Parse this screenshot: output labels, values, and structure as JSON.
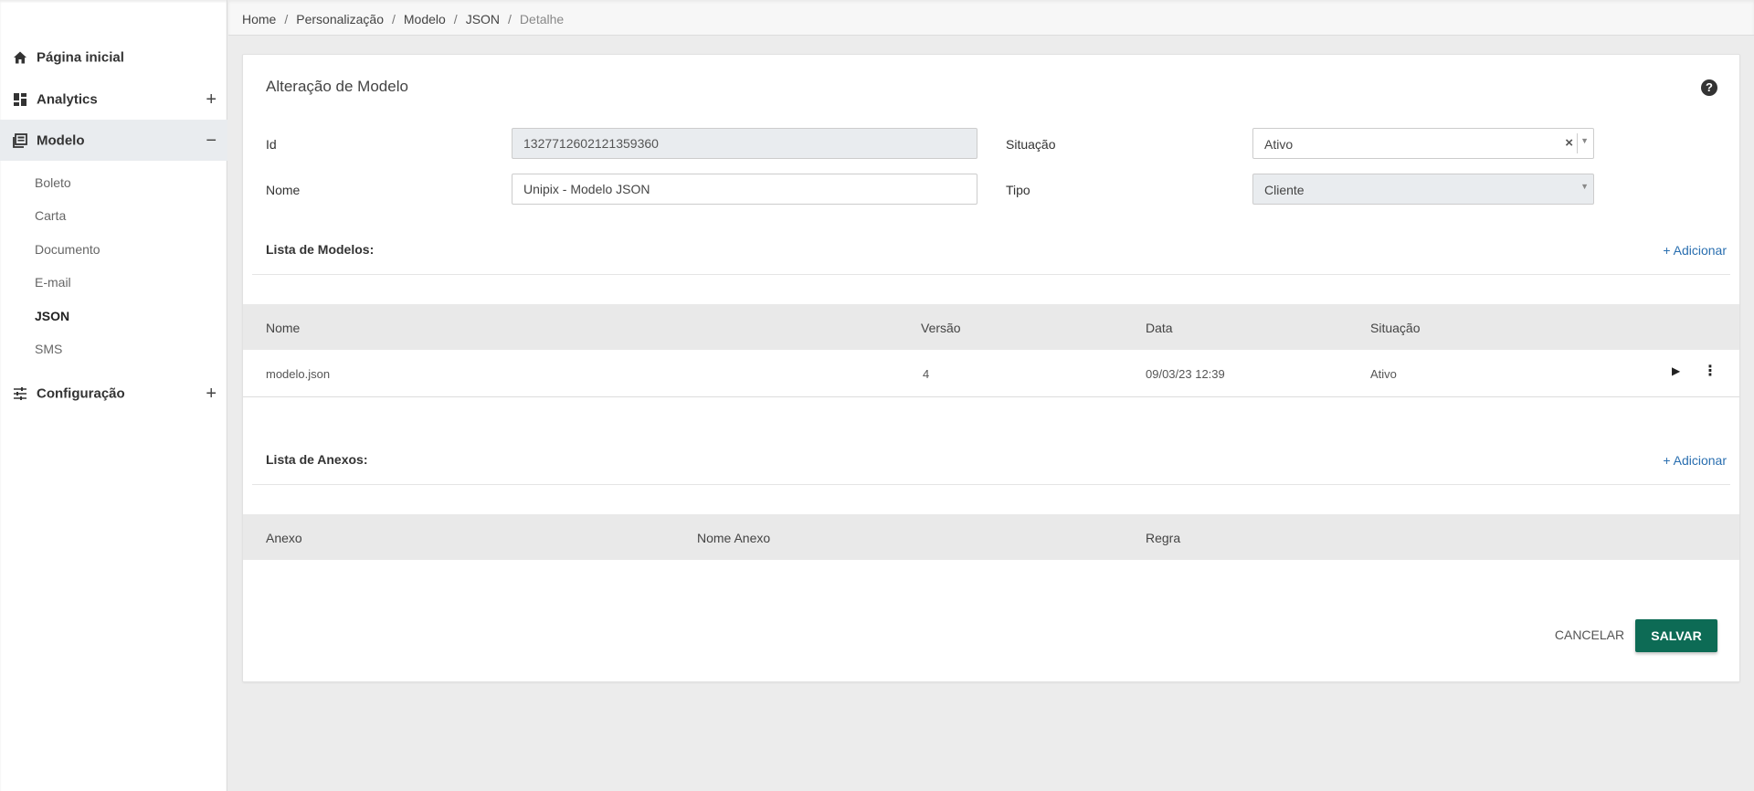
{
  "sidebar": {
    "items": [
      {
        "label": "Página inicial",
        "icon": "home-icon"
      },
      {
        "label": "Analytics",
        "icon": "dashboard-icon",
        "toggle": "+"
      },
      {
        "label": "Modelo",
        "icon": "book-icon",
        "toggle": "−"
      },
      {
        "label": "Configuração",
        "icon": "sliders-icon",
        "toggle": "+"
      }
    ],
    "subitems": [
      "Boleto",
      "Carta",
      "Documento",
      "E-mail",
      "JSON",
      "SMS"
    ]
  },
  "breadcrumb": [
    "Home",
    "Personalização",
    "Modelo",
    "JSON",
    "Detalhe"
  ],
  "breadcrumb_sep": "/",
  "form": {
    "title": "Alteração de Modelo",
    "help": "?",
    "id_label": "Id",
    "id_value": "1327712602121359360",
    "nome_label": "Nome",
    "nome_value": "Unipix - Modelo JSON",
    "situacao_label": "Situação",
    "situacao_value": "Ativo",
    "tipo_label": "Tipo",
    "tipo_value": "Cliente"
  },
  "modelos": {
    "title": "Lista de Modelos:",
    "add": "+ Adicionar",
    "columns": [
      "Nome",
      "Versão",
      "Data",
      "Situação"
    ],
    "rows": [
      {
        "nome": "modelo.json",
        "versao": "4",
        "data": "09/03/23 12:39",
        "situacao": "Ativo"
      }
    ]
  },
  "anexos": {
    "title": "Lista de Anexos:",
    "add": "+ Adicionar",
    "columns": [
      "Anexo",
      "Nome Anexo",
      "Regra"
    ]
  },
  "actions": {
    "cancel": "CANCELAR",
    "save": "SALVAR"
  },
  "colors": {
    "primary": "#0d6b55",
    "link": "#2a6fb0"
  }
}
